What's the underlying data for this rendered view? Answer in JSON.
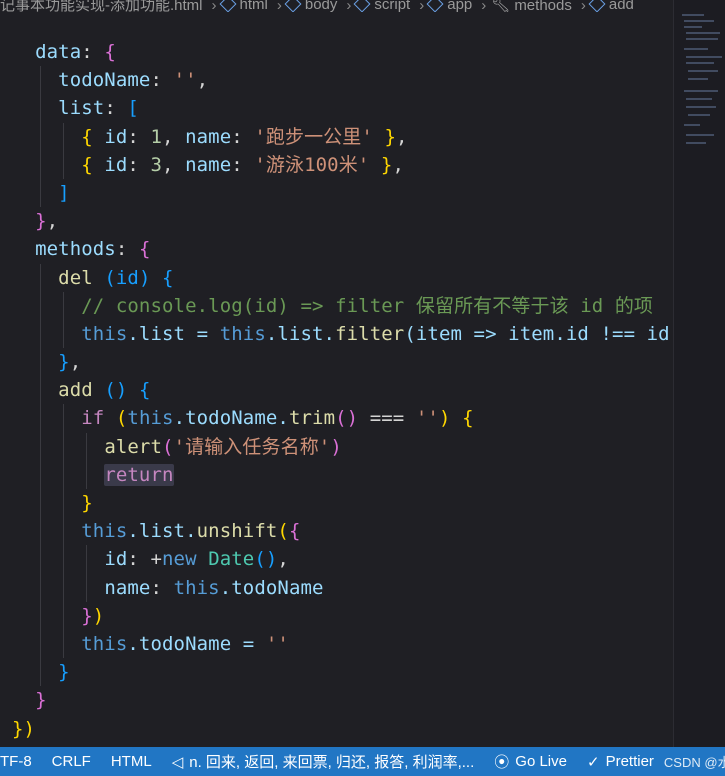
{
  "breadcrumb": [
    {
      "label": "记事本功能实现-添加功能.html",
      "icon": "none"
    },
    {
      "label": "html",
      "icon": "cube-icon"
    },
    {
      "label": "body",
      "icon": "cube-icon"
    },
    {
      "label": "script",
      "icon": "cube-icon"
    },
    {
      "label": "app",
      "icon": "cube-icon"
    },
    {
      "label": "methods",
      "icon": "wrench-icon"
    },
    {
      "label": "add",
      "icon": "cube-icon"
    }
  ],
  "code": {
    "l1": {
      "key": "data",
      "colon": ":",
      "brace": "{"
    },
    "l2": {
      "key": "todoName",
      "colon": ":",
      "str": "''",
      "comma": ","
    },
    "l3": {
      "key": "list",
      "colon": ":",
      "bracket": "["
    },
    "l4": {
      "open": "{",
      "k1": "id",
      "v1": "1",
      "k2": "name",
      "v2": "'跑步一公里'",
      "close": "}",
      "comma": ","
    },
    "l5": {
      "open": "{",
      "k1": "id",
      "v1": "3",
      "k2": "name",
      "v2": "'游泳100米'",
      "close": "}",
      "comma": ","
    },
    "l6": {
      "bracket": "]"
    },
    "l7": {
      "brace": "}",
      "comma": ","
    },
    "l8": {
      "key": "methods",
      "colon": ":",
      "brace": "{"
    },
    "l9": {
      "fn": "del",
      "param": "(id)",
      "brace": "{"
    },
    "l10": {
      "comment": "// console.log(id) => filter 保留所有不等于该 id 的项"
    },
    "l11": {
      "this1": "this",
      "p1": ".list = ",
      "this2": "this",
      "p2": ".list.",
      "fn": "filter",
      "rest": "(item => item.id !== id)"
    },
    "l12": {
      "brace": "}",
      "comma": ","
    },
    "l13": {
      "fn": "add",
      "paren": "()",
      "brace": "{"
    },
    "l14": {
      "kw": "if",
      "open": "(",
      "thisw": "this",
      "p1": ".todoName.",
      "fn": "trim",
      "call": "()",
      "op": " === ",
      "str": "''",
      "close": ")",
      "brace": "{"
    },
    "l15": {
      "fn": "alert",
      "open": "(",
      "str": "'请输入任务名称'",
      "close": ")"
    },
    "l16": {
      "kw": "return"
    },
    "l17": {
      "brace": "}"
    },
    "l18": {
      "thisw": "this",
      "p1": ".list.",
      "fn": "unshift",
      "open": "(",
      "brace": "{"
    },
    "l19": {
      "key": "id",
      "colon": ":",
      "plus": " +",
      "kw": "new",
      "cls": "Date",
      "call": "()",
      "comma": ","
    },
    "l20": {
      "key": "name",
      "colon": ":",
      "thisw": "this",
      "p1": ".todoName"
    },
    "l21": {
      "brace": "}",
      "close": ")"
    },
    "l22": {
      "thisw": "this",
      "p1": ".todoName = ",
      "str": "''"
    },
    "l23": {
      "brace": "}"
    },
    "l24": {
      "brace": "}"
    },
    "l25": {
      "brace": "}",
      "close": ")"
    }
  },
  "statusbar": {
    "encoding": "TF-8",
    "eol": "CRLF",
    "language": "HTML",
    "translation": "n. 回来, 返回, 来回票, 归还, 报答, 利润率,...",
    "golive": "Go Live",
    "prettier": "Prettier",
    "watermark": "CSDN @水无尼"
  },
  "colors": {
    "background": "#1f1f24",
    "statusbar": "#2176c4",
    "string": "#ce9178",
    "keyword": "#569cd6",
    "property": "#9cdcfe",
    "function": "#dcdcaa",
    "comment": "#6a9955"
  }
}
